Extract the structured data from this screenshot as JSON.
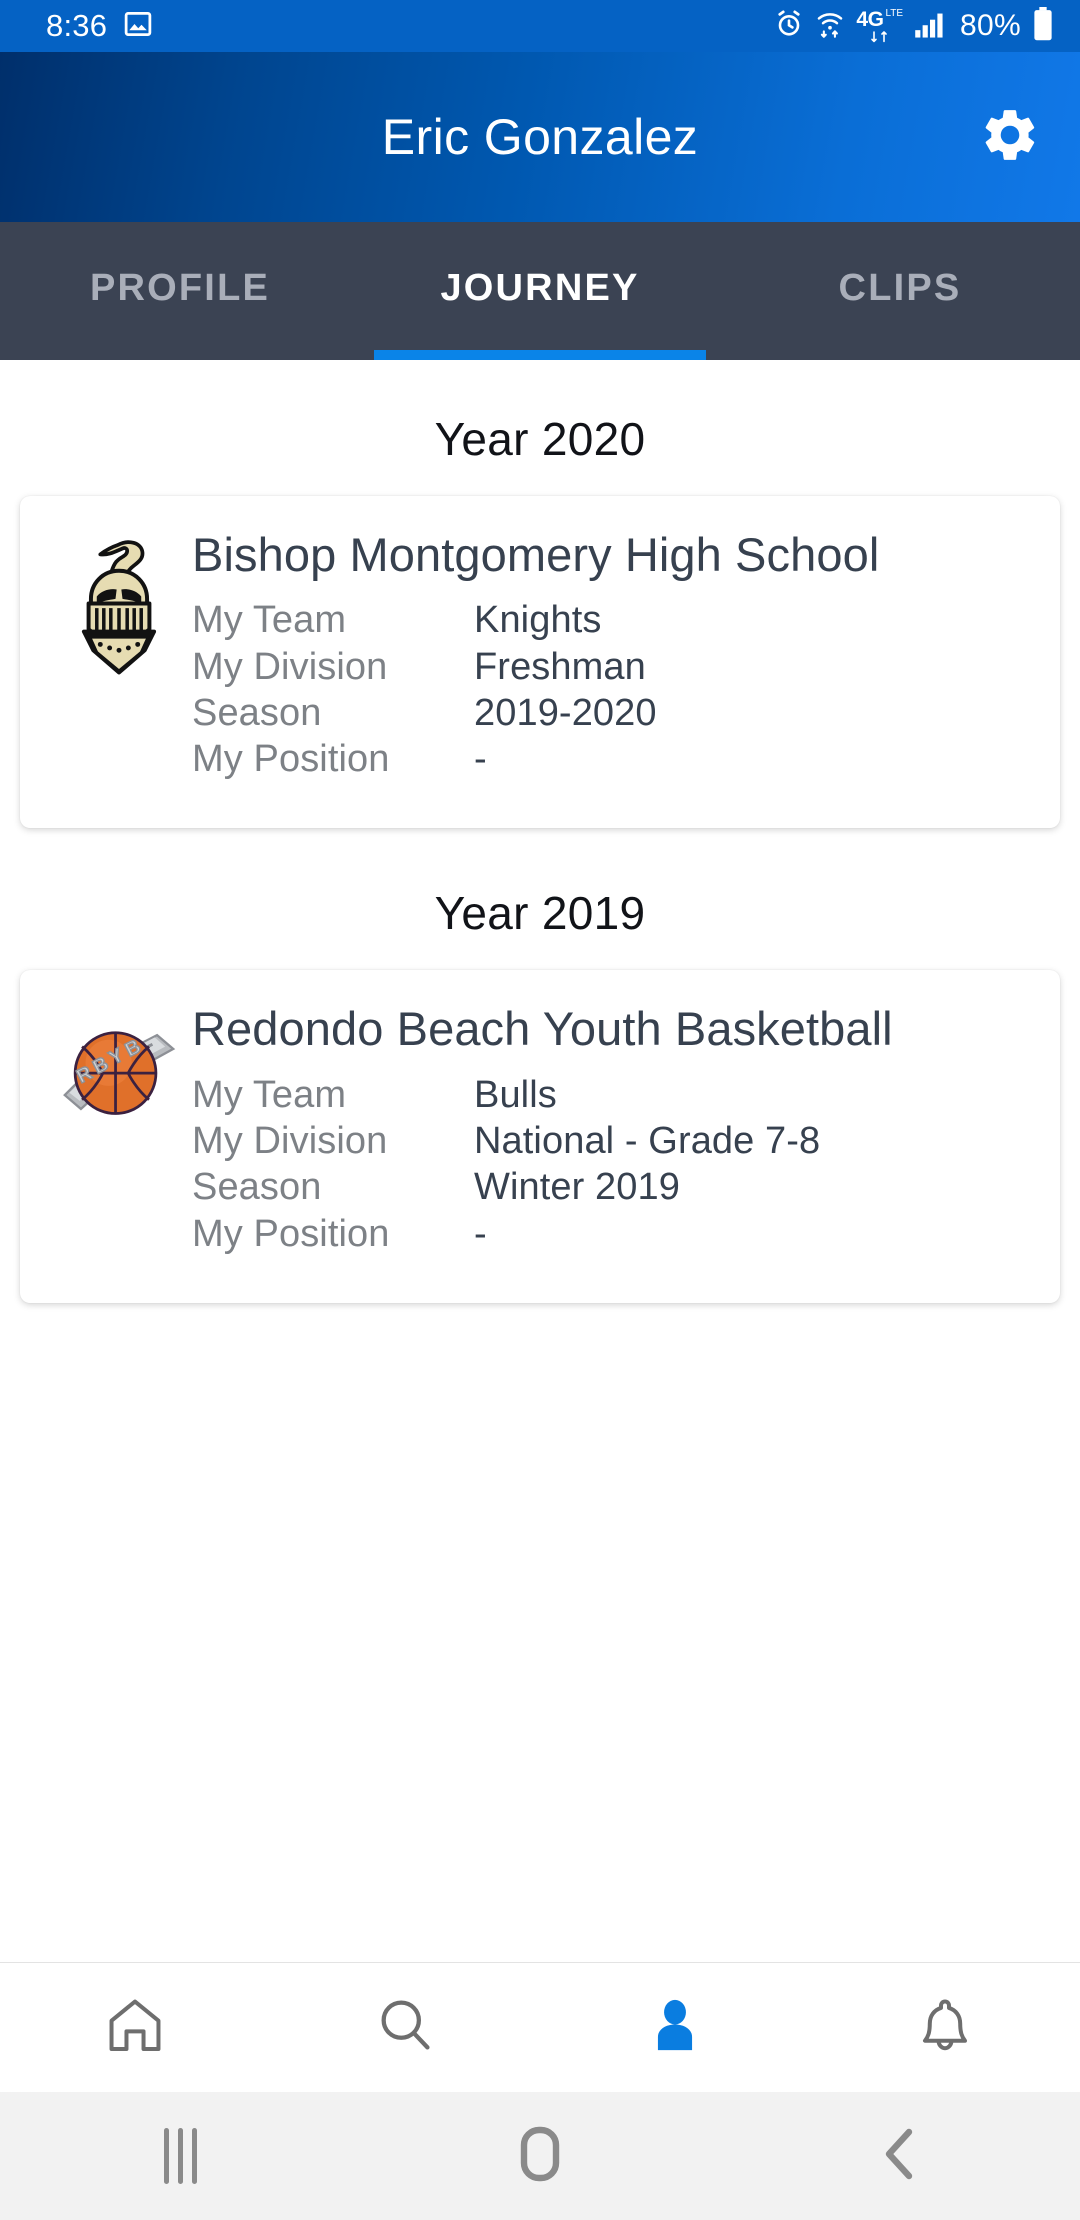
{
  "status_bar": {
    "time": "8:36",
    "battery_percent": "80%",
    "network_label": "4G",
    "network_sub": "LTE",
    "icons": [
      "image-icon",
      "alarm-icon",
      "wifi-icon",
      "network-4glte-icon",
      "signal-bars-icon",
      "battery-icon"
    ],
    "background_color": "#0562c4"
  },
  "header": {
    "title": "Eric Gonzalez",
    "settings_icon": "gear-icon",
    "gradient_from": "#002f6b",
    "gradient_to": "#1178e8"
  },
  "tabs": {
    "items": [
      {
        "label": "PROFILE",
        "active": false
      },
      {
        "label": "JOURNEY",
        "active": true
      },
      {
        "label": "CLIPS",
        "active": false
      }
    ],
    "active_index": 1,
    "bar_color": "#3b4353",
    "indicator_color": "#0a84e8",
    "active_text_color": "#ffffff",
    "inactive_text_color": "#a9aeb9"
  },
  "journey": {
    "sections": [
      {
        "year_heading": "Year 2020",
        "card": {
          "logo": "knight-helmet-logo",
          "title": "Bishop Montgomery High School",
          "rows": [
            {
              "label": "My Team",
              "value": "Knights"
            },
            {
              "label": "My Division",
              "value": "Freshman"
            },
            {
              "label": "Season",
              "value": "2019-2020"
            },
            {
              "label": "My Position",
              "value": "-"
            }
          ]
        }
      },
      {
        "year_heading": "Year 2019",
        "card": {
          "logo": "basketball-rbyb-logo",
          "title": "Redondo Beach Youth Basketball",
          "rows": [
            {
              "label": "My Team",
              "value": "Bulls"
            },
            {
              "label": "My Division",
              "value": "National - Grade 7-8"
            },
            {
              "label": "Season",
              "value": "Winter 2019"
            },
            {
              "label": "My Position",
              "value": "-"
            }
          ]
        }
      }
    ]
  },
  "bottom_nav": {
    "items": [
      {
        "icon": "home-icon",
        "active": false
      },
      {
        "icon": "search-icon",
        "active": false
      },
      {
        "icon": "person-icon",
        "active": true
      },
      {
        "icon": "bell-icon",
        "active": false
      }
    ],
    "active_color": "#0a7de0",
    "inactive_color": "#6e6e6e"
  },
  "system_nav": {
    "items": [
      {
        "icon": "recents-icon"
      },
      {
        "icon": "home-square-icon"
      },
      {
        "icon": "back-chevron-icon"
      }
    ],
    "background_color": "#f2f2f2",
    "icon_color": "#8a8a8a"
  }
}
